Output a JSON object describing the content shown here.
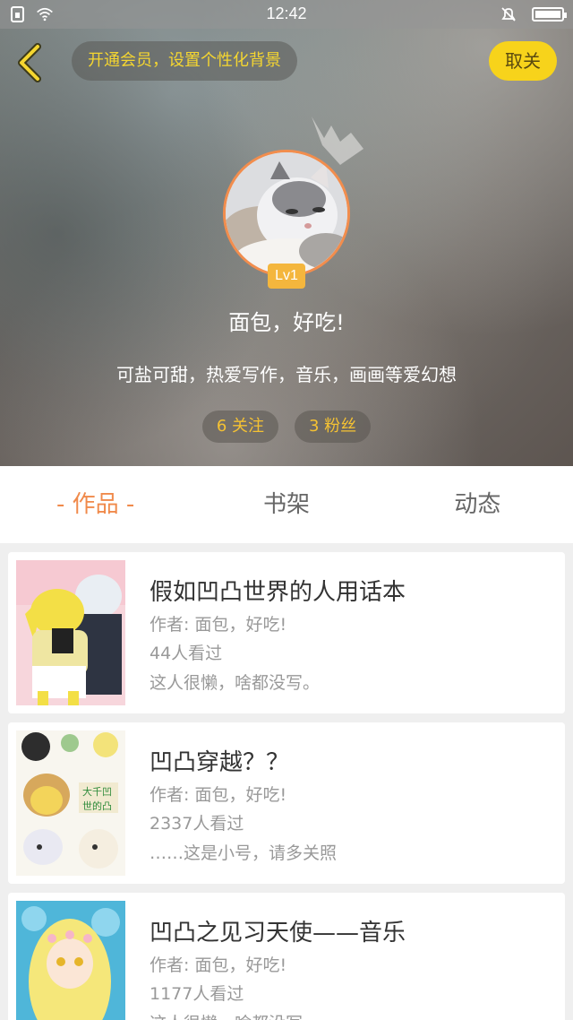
{
  "status_bar": {
    "time": "12:42"
  },
  "header": {
    "vip_prompt": "开通会员，设置个性化背景",
    "unfollow_label": "取关",
    "level": "Lv1",
    "username": "面包，好吃!",
    "bio": "可盐可甜，热爱写作，音乐，画画等爱幻想",
    "following": "6 关注",
    "followers": "3 粉丝"
  },
  "tabs": [
    {
      "label": "- 作品 -"
    },
    {
      "label": "书架"
    },
    {
      "label": "动态"
    }
  ],
  "works": [
    {
      "title": "假如凹凸世界的人用话本",
      "author": "作者: 面包，好吃!",
      "views": "44人看过",
      "desc": "这人很懒，啥都没写。"
    },
    {
      "title": "凹凸穿越？？",
      "author": "作者: 面包，好吃!",
      "views": "2337人看过",
      "desc": "……这是小号，请多关照"
    },
    {
      "title": "凹凸之见习天使——音乐",
      "author": "作者: 面包，好吃!",
      "views": "1177人看过",
      "desc": "这人很懒，啥都没写。"
    }
  ],
  "colors": {
    "accent": "#f08a4b",
    "vip_yellow": "#f7d31b",
    "level_badge": "#f4b63d"
  }
}
